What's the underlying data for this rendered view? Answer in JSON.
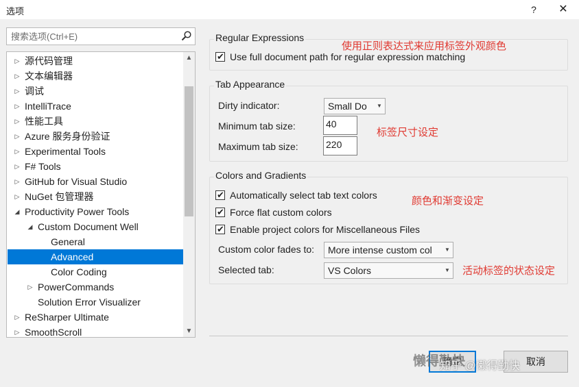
{
  "window": {
    "title": "选项",
    "help_glyph": "?",
    "close_glyph": "✕"
  },
  "search": {
    "placeholder": "搜索选项(Ctrl+E)"
  },
  "tree": {
    "items": [
      {
        "label": "源代码管理",
        "level": 0,
        "arrow": "▷",
        "selected": false
      },
      {
        "label": "文本编辑器",
        "level": 0,
        "arrow": "▷",
        "selected": false
      },
      {
        "label": "调试",
        "level": 0,
        "arrow": "▷",
        "selected": false
      },
      {
        "label": "IntelliTrace",
        "level": 0,
        "arrow": "▷",
        "selected": false
      },
      {
        "label": "性能工具",
        "level": 0,
        "arrow": "▷",
        "selected": false
      },
      {
        "label": "Azure 服务身份验证",
        "level": 0,
        "arrow": "▷",
        "selected": false
      },
      {
        "label": "Experimental Tools",
        "level": 0,
        "arrow": "▷",
        "selected": false
      },
      {
        "label": "F# Tools",
        "level": 0,
        "arrow": "▷",
        "selected": false
      },
      {
        "label": "GitHub for Visual Studio",
        "level": 0,
        "arrow": "▷",
        "selected": false
      },
      {
        "label": "NuGet 包管理器",
        "level": 0,
        "arrow": "▷",
        "selected": false
      },
      {
        "label": "Productivity Power Tools",
        "level": 0,
        "arrow": "◢",
        "selected": false
      },
      {
        "label": "Custom Document Well",
        "level": 1,
        "arrow": "◢",
        "selected": false
      },
      {
        "label": "General",
        "level": 2,
        "arrow": "",
        "selected": false
      },
      {
        "label": "Advanced",
        "level": 2,
        "arrow": "",
        "selected": true
      },
      {
        "label": "Color Coding",
        "level": 2,
        "arrow": "",
        "selected": false
      },
      {
        "label": "PowerCommands",
        "level": 1,
        "arrow": "▷",
        "selected": false
      },
      {
        "label": "Solution Error Visualizer",
        "level": 1,
        "arrow": "",
        "selected": false
      },
      {
        "label": "ReSharper Ultimate",
        "level": 0,
        "arrow": "▷",
        "selected": false
      },
      {
        "label": "SmoothScroll",
        "level": 0,
        "arrow": "▷",
        "selected": false
      }
    ]
  },
  "regex_group": {
    "title": "Regular Expressions",
    "use_full_path": {
      "label": "Use full document path for regular expression matching",
      "checked": true
    },
    "note": "使用正则表达式来应用标签外观颜色"
  },
  "tab_group": {
    "title": "Tab Appearance",
    "dirty_indicator": {
      "label": "Dirty indicator:",
      "value": "Small Do"
    },
    "min_tab_size": {
      "label": "Minimum tab size:",
      "value": "40"
    },
    "max_tab_size": {
      "label": "Maximum tab size:",
      "value": "220"
    },
    "note": "标签尺寸设定"
  },
  "colors_group": {
    "title": "Colors and Gradients",
    "auto_select": {
      "label": "Automatically select tab text colors",
      "checked": true
    },
    "force_flat": {
      "label": "Force flat custom colors",
      "checked": true
    },
    "project_colors": {
      "label": "Enable project colors for Miscellaneous Files",
      "checked": true
    },
    "fades_to": {
      "label": "Custom color fades to:",
      "value": "More intense custom col"
    },
    "selected_tab": {
      "label": "Selected tab:",
      "value": "VS Colors"
    },
    "note_colors": "颜色和渐变设定",
    "note_selected": "活动标签的状态设定"
  },
  "buttons": {
    "ok": "确定",
    "cancel": "取消"
  },
  "watermark": {
    "text1": "懒得勤快",
    "text2": "知乎 @懒得勤快"
  },
  "colors": {
    "accent": "#0078d7",
    "note": "#e03a32"
  }
}
